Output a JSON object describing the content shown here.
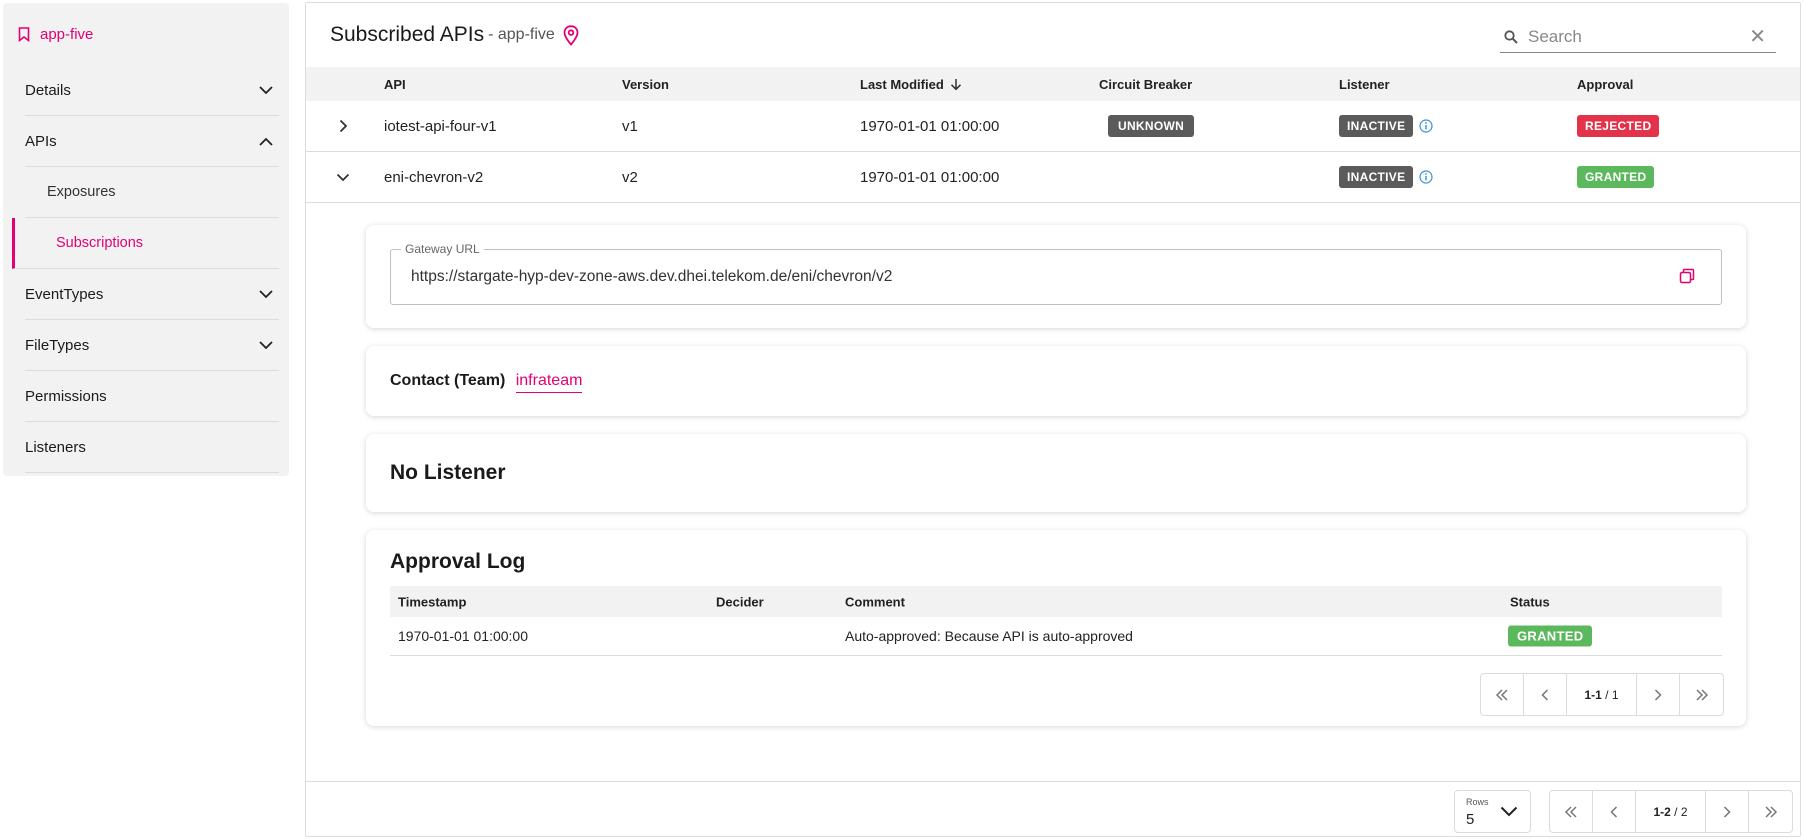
{
  "sidebar": {
    "app_name": "app-five",
    "items": [
      {
        "label": "Details"
      },
      {
        "label": "APIs"
      },
      {
        "label": "Exposures"
      },
      {
        "label": "Subscriptions"
      },
      {
        "label": "EventTypes"
      },
      {
        "label": "FileTypes"
      },
      {
        "label": "Permissions"
      },
      {
        "label": "Listeners"
      }
    ]
  },
  "header": {
    "title": "Subscribed APIs",
    "subtitle": "- app-five",
    "search_placeholder": "Search"
  },
  "table": {
    "columns": [
      "API",
      "Version",
      "Last Modified",
      "Circuit Breaker",
      "Listener",
      "Approval"
    ],
    "rows": [
      {
        "api": "iotest-api-four-v1",
        "version": "v1",
        "last_modified": "1970-01-01 01:00:00",
        "circuit_breaker": "UNKNOWN",
        "listener": "INACTIVE",
        "approval": "REJECTED"
      },
      {
        "api": "eni-chevron-v2",
        "version": "v2",
        "last_modified": "1970-01-01 01:00:00",
        "circuit_breaker": "",
        "listener": "INACTIVE",
        "approval": "GRANTED"
      }
    ]
  },
  "detail": {
    "gateway_label": "Gateway URL",
    "gateway_url": "https://stargate-hyp-dev-zone-aws.dev.dhei.telekom.de/eni/chevron/v2",
    "contact_label": "Contact (Team)",
    "contact_value": "infrateam",
    "no_listener": "No Listener",
    "approval_log": {
      "title": "Approval Log",
      "columns": [
        "Timestamp",
        "Decider",
        "Comment",
        "Status"
      ],
      "rows": [
        {
          "timestamp": "1970-01-01 01:00:00",
          "decider": "",
          "comment": "Auto-approved: Because API is auto-approved",
          "status": "GRANTED"
        }
      ],
      "pagination": {
        "current": "1-1",
        "total": "1"
      }
    }
  },
  "footer": {
    "rows_label": "Rows",
    "rows_value": "5",
    "pagination": {
      "current": "1-2",
      "total": "2"
    }
  },
  "colors": {
    "brand": "#e20074",
    "granted": "#5cb85c",
    "rejected": "#e3334b",
    "neutral_badge": "#5b5b5b"
  }
}
